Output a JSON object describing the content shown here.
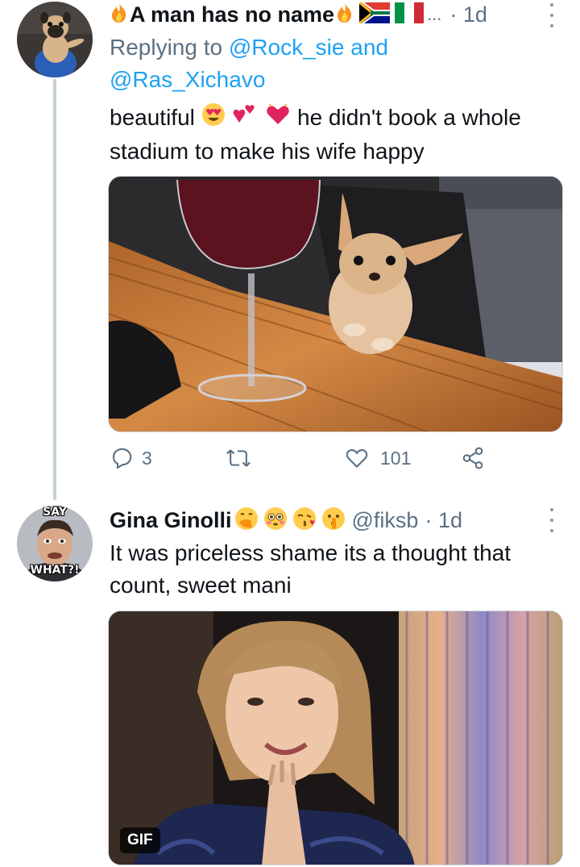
{
  "tweets": [
    {
      "author": "A man has no name",
      "truncation": "...",
      "time": "· 1d",
      "reply": {
        "prefix": "Replying to",
        "mention1": "@Rock_sie",
        "conj": "and",
        "mention2": "@Ras_Xichavo"
      },
      "text_start": "beautiful",
      "text_end": " he didn't book a whole stadium to make his wife happy",
      "stats": {
        "replies": "3",
        "likes": "101"
      }
    },
    {
      "author": "Gina Ginolli",
      "handle": "@fiksb",
      "time": "· 1d",
      "text": "It was priceless shame its a thought that count, sweet mani",
      "avatar_caption_top": "SAY",
      "avatar_caption_bottom": "WHAT?!",
      "media_badge": "GIF"
    }
  ],
  "icons": [
    "fire-icon",
    "south-africa-flag-icon",
    "italy-flag-icon",
    "heart-eyes-emoji",
    "hearts-emoji",
    "reply-icon",
    "retweet-icon",
    "like-icon",
    "share-icon",
    "more-icon",
    "hand-over-mouth-emoji",
    "flushed-emoji",
    "kiss-emoji",
    "shushing-emoji"
  ],
  "colors": {
    "link": "#1da1f2",
    "muted": "#5b7083",
    "thread_line": "#c4cfd6",
    "text": "#0f1419"
  }
}
